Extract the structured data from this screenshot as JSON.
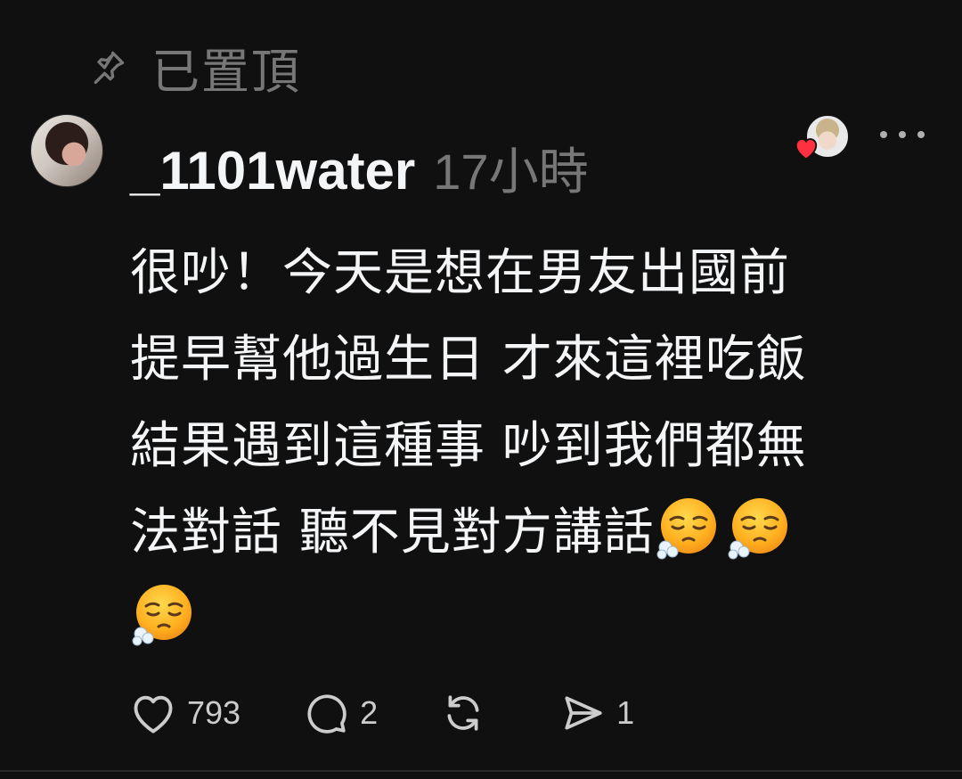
{
  "pinned": {
    "icon": "pin-icon",
    "label": "已置頂"
  },
  "post": {
    "author": {
      "username": "_1101water",
      "avatar_icon": "avatar"
    },
    "timestamp": "17小時",
    "liked_by_icon": "heart-icon",
    "more_icon": "more-icon",
    "text_lines": [
      "很吵！今天是想在男友出國前",
      "提早幫他過生日 才來這裡吃飯",
      "結果遇到這種事 吵到我們都無",
      "法對話 聽不見對方講話"
    ],
    "emoji": {
      "name": "face-exhaling-emoji",
      "count": 3
    }
  },
  "actions": {
    "like": {
      "icon": "heart-icon",
      "count": "793"
    },
    "comment": {
      "icon": "comment-icon",
      "count": "2"
    },
    "repost": {
      "icon": "repost-icon",
      "count": ""
    },
    "share": {
      "icon": "send-icon",
      "count": "1"
    }
  },
  "colors": {
    "background": "#101010",
    "text_primary": "#f3f5f7",
    "text_secondary": "#777777",
    "heart_red": "#ff3040"
  }
}
